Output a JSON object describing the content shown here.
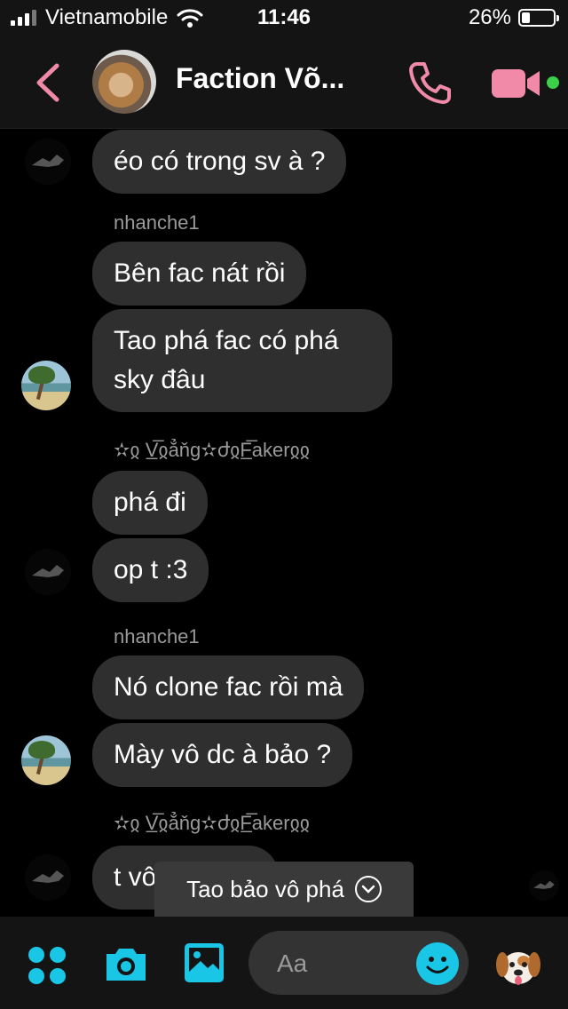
{
  "status_bar": {
    "carrier": "Vietnamobile",
    "time": "11:46",
    "battery": "26%",
    "battery_level": 0.26
  },
  "header": {
    "title": "Faction Võ...",
    "accent": "#f08aa8",
    "online_color": "#3ccf4a"
  },
  "messages": {
    "m1": "éo có trong sv à ?",
    "sender1": "nhanche1",
    "m2": "Bên fac nát rồi",
    "m3": "Tao phá fac có phá sky đâu",
    "sender2": "✫ჲ V̲̅ჲẳňg✫ժჲF̲̅akerჲჲ",
    "m4": "phá đi",
    "m5": "op t :3",
    "sender3": "nhanche1",
    "m6": "Nó clone fac rồi mà",
    "m7": "Mày vô dc à bảo ?",
    "sender4": "✫ჲ V̲̅ჲẳňg✫ժჲF̲̅akerჲჲ",
    "m8": "t vô"
  },
  "toast": {
    "text": "Tao bảo vô phá"
  },
  "composer": {
    "placeholder": "Aa",
    "accent": "#19c6e6"
  }
}
